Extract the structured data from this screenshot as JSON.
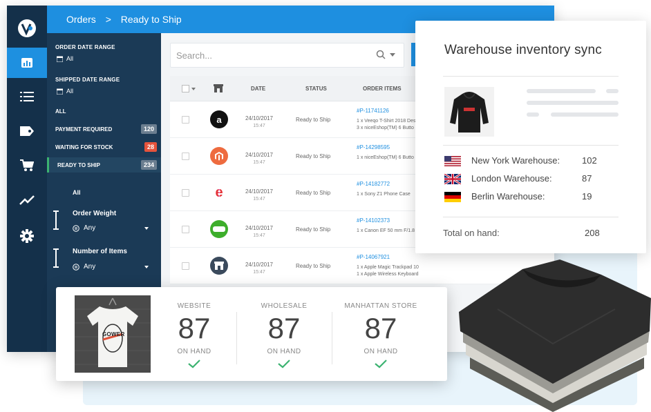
{
  "header": {
    "crumb_root": "Orders",
    "crumb_sep": ">",
    "crumb_current": "Ready to Ship"
  },
  "sidebar_icons": [
    "dashboard-icon",
    "list-icon",
    "tag-icon",
    "cart-icon",
    "trending-icon",
    "settings-icon"
  ],
  "filters": {
    "order_date_label": "ORDER DATE RANGE",
    "order_date_value": "All",
    "shipped_date_label": "SHIPPED DATE RANGE",
    "shipped_date_value": "All",
    "all_label": "ALL",
    "statuses": [
      {
        "label": "PAYMENT REQUIRED",
        "count": "120"
      },
      {
        "label": "WAITING FOR STOCK",
        "count": "28"
      },
      {
        "label": "READY TO SHIP",
        "count": "234"
      }
    ],
    "all_option": "All",
    "weight_label": "Order Weight",
    "weight_value": "Any",
    "items_label": "Number of Items",
    "items_value": "Any"
  },
  "search": {
    "placeholder": "Search..."
  },
  "table": {
    "columns": {
      "date": "DATE",
      "status": "STATUS",
      "order_items": "ORDER ITEMS"
    },
    "rows": [
      {
        "store": "amazon",
        "date": "24/10/2017",
        "time": "15:47",
        "status": "Ready to Ship",
        "id": "#P-11741126",
        "items": [
          "1 x Veeqo T-Shirt 2018 Des",
          "3 x niceEshop(TM) 6 Butto"
        ]
      },
      {
        "store": "magento",
        "date": "24/10/2017",
        "time": "15:47",
        "status": "Ready to Ship",
        "id": "#P-14298595",
        "items": [
          "1 x niceEshop(TM) 6 Butto"
        ]
      },
      {
        "store": "ebay",
        "date": "24/10/2017",
        "time": "15:47",
        "status": "Ready to Ship",
        "id": "#P-14182772",
        "items": [
          "1 x Sony Z1 Phone Case"
        ]
      },
      {
        "store": "woo",
        "date": "24/10/2017",
        "time": "15:47",
        "status": "Ready to Ship",
        "id": "#P-14102373",
        "items": [
          "1 x Canon EF 50 mm F/1.8"
        ]
      },
      {
        "store": "store",
        "date": "24/10/2017",
        "time": "15:47",
        "status": "Ready to Ship",
        "id": "#P-14067921",
        "items": [
          "1 x Apple Magic Trackpad 10 x",
          "1 x Apple Wireless Keyboard"
        ]
      }
    ]
  },
  "warehouse": {
    "title": "Warehouse inventory sync",
    "rows": [
      {
        "name": "New York Warehouse:",
        "qty": "102"
      },
      {
        "name": "London Warehouse:",
        "qty": "87"
      },
      {
        "name": "Berlin Warehouse:",
        "qty": "19"
      }
    ],
    "total_label": "Total on hand:",
    "total_value": "208"
  },
  "stock": {
    "tee_text": "GOWER",
    "channels": [
      {
        "label": "WEBSITE",
        "value": "87",
        "sub": "ON HAND"
      },
      {
        "label": "WHOLESALE",
        "value": "87",
        "sub": "ON HAND"
      },
      {
        "label": "MANHATTAN STORE",
        "value": "87",
        "sub": "ON HAND"
      }
    ]
  },
  "colors": {
    "accent": "#1e8fe0",
    "rail": "#14304a",
    "filters": "#1b3a56",
    "success": "#3cb371",
    "danger": "#e5533c"
  }
}
